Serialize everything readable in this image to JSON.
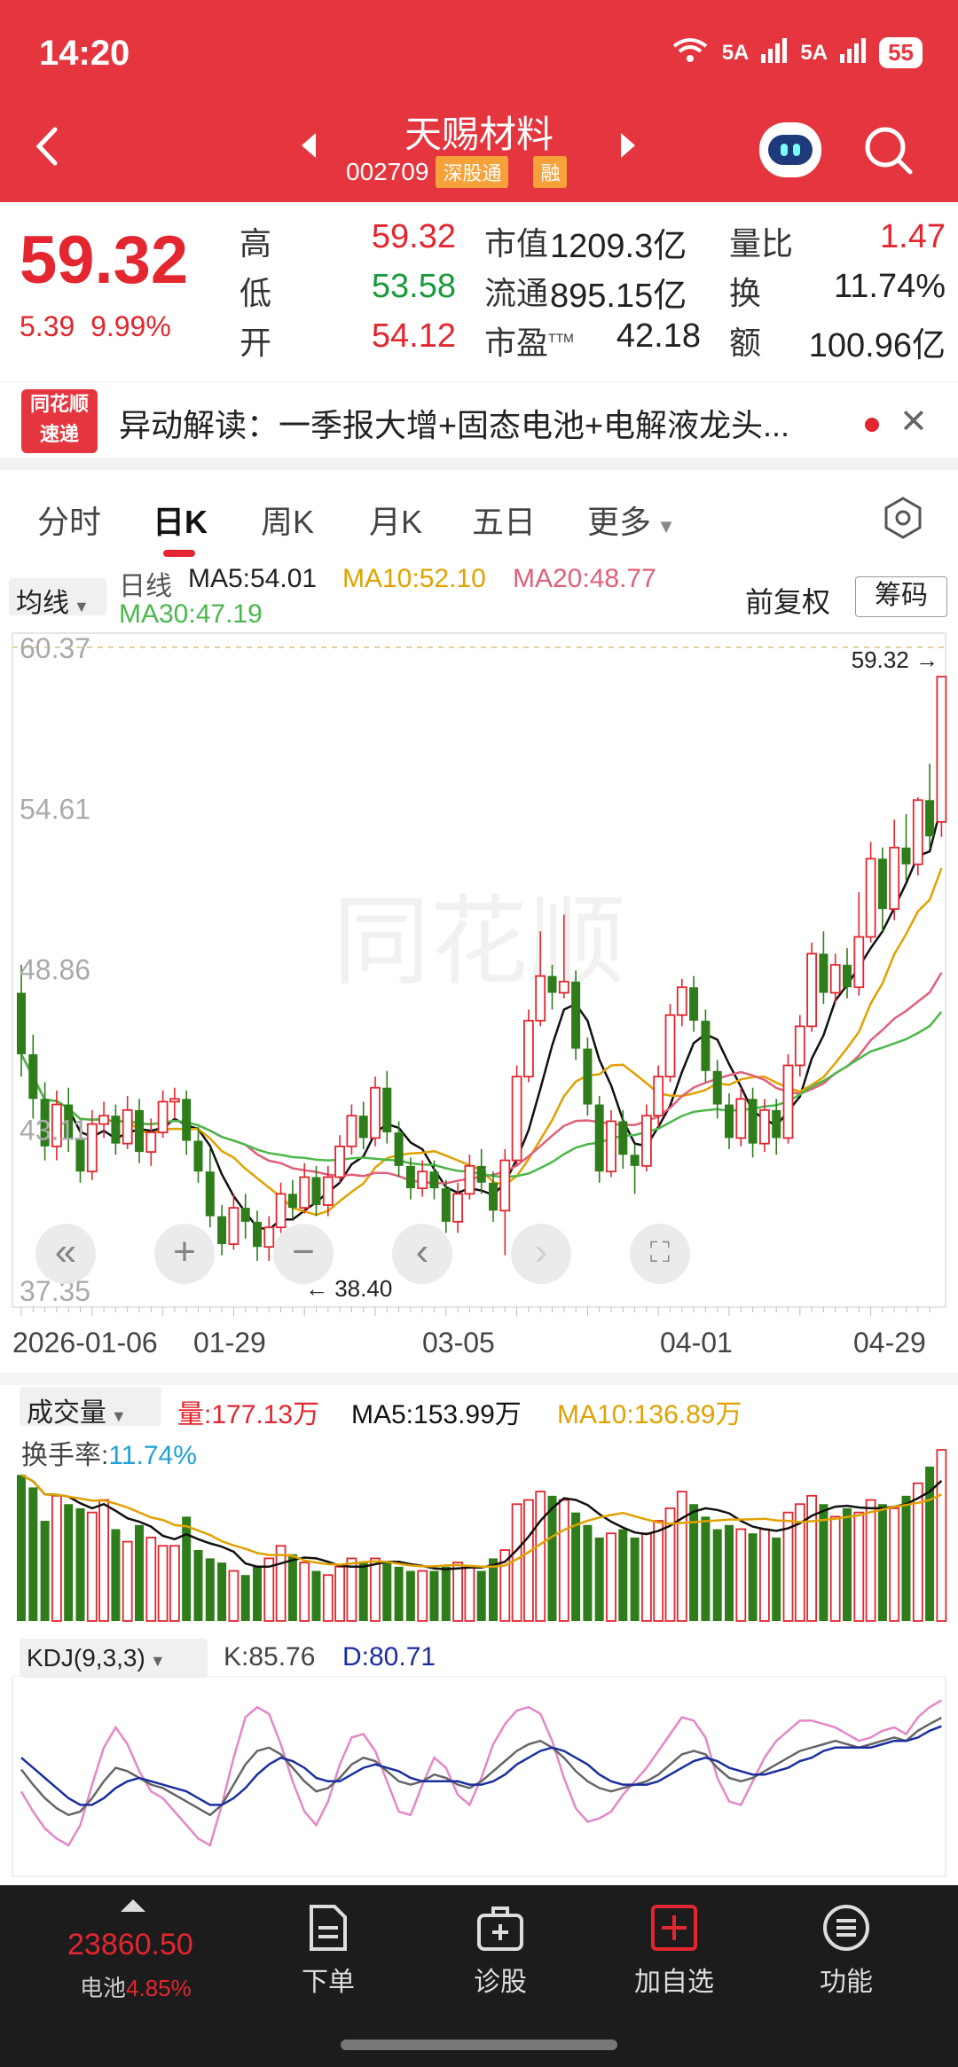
{
  "status": {
    "time": "14:20",
    "signal1": "5A",
    "signal2": "5A",
    "battery": "55"
  },
  "header": {
    "title": "天赐材料",
    "code": "002709",
    "tag1": "深股通",
    "tag2": "融"
  },
  "quote": {
    "price": "59.32",
    "change": "5.39",
    "change_pct": "9.99%",
    "high_label": "高",
    "high": "59.32",
    "low_label": "低",
    "low": "53.58",
    "open_label": "开",
    "open": "54.12",
    "mcap_label": "市值",
    "mcap": "1209.3亿",
    "float_label": "流通",
    "float": "895.15亿",
    "pe_label": "市盈",
    "pe_sup": "TTM",
    "pe": "42.18",
    "vr_label": "量比",
    "vr": "1.47",
    "turn_label": "换",
    "turn": "11.74%",
    "amt_label": "额",
    "amt": "100.96亿"
  },
  "news": {
    "logo_top": "同花顺",
    "logo_bottom": "速递",
    "text": "异动解读：一季报大增+固态电池+电解液龙头..."
  },
  "tabs": [
    "分时",
    "日K",
    "周K",
    "月K",
    "五日",
    "更多"
  ],
  "ma": {
    "select": "均线",
    "period": "日线",
    "ma5": "MA5:54.01",
    "ma10": "MA10:52.10",
    "ma20": "MA20:48.77",
    "ma30": "MA30:47.19",
    "fuquan": "前复权",
    "chouma": "筹码"
  },
  "kline": {
    "y_ticks": [
      "60.37",
      "54.61",
      "48.86",
      "43.11",
      "37.35"
    ],
    "max_label": "59.32",
    "min_label": "38.40",
    "dates": [
      "2026-01-06",
      "01-29",
      "03-05",
      "04-01",
      "04-29"
    ],
    "watermark": "同花顺"
  },
  "volume": {
    "select": "成交量",
    "vol": "量:177.13万",
    "ma5": "MA5:153.99万",
    "ma10": "MA10:136.89万",
    "turn_label": "换手率:",
    "turn": "11.74%"
  },
  "kdj": {
    "select": "KDJ(9,3,3)",
    "k": "K:85.76",
    "d": "D:80.71"
  },
  "bottom": {
    "index_value": "23860.50",
    "index_name": "电池",
    "index_pct": "4.85%",
    "items": [
      "下单",
      "诊股",
      "加自选",
      "功能"
    ]
  },
  "chart_data": {
    "type": "candlestick",
    "x_labels": [
      "2026-01-06",
      "01-29",
      "03-05",
      "04-01",
      "04-29"
    ],
    "ylim": [
      37.35,
      60.37
    ],
    "candles": [
      [
        48.0,
        45.8,
        49.0,
        45.0
      ],
      [
        45.8,
        44.2,
        46.5,
        43.5
      ],
      [
        44.2,
        42.5,
        44.8,
        42.0
      ],
      [
        42.5,
        44.0,
        44.5,
        42.0
      ],
      [
        44.0,
        42.8,
        44.6,
        42.3
      ],
      [
        42.8,
        41.6,
        43.4,
        41.2
      ],
      [
        41.6,
        43.3,
        43.8,
        41.3
      ],
      [
        43.3,
        43.6,
        44.1,
        42.8
      ],
      [
        43.6,
        42.6,
        44.0,
        42.2
      ],
      [
        42.6,
        43.8,
        44.3,
        42.4
      ],
      [
        43.8,
        42.3,
        44.2,
        41.9
      ],
      [
        42.3,
        43.0,
        43.5,
        41.8
      ],
      [
        43.0,
        44.1,
        44.5,
        42.8
      ],
      [
        44.1,
        44.2,
        44.6,
        43.5
      ],
      [
        44.2,
        42.7,
        44.5,
        42.2
      ],
      [
        42.7,
        41.6,
        43.2,
        41.2
      ],
      [
        41.6,
        40.0,
        42.4,
        39.6
      ],
      [
        40.0,
        39.0,
        40.4,
        38.6
      ],
      [
        39.0,
        40.3,
        40.8,
        38.8
      ],
      [
        40.3,
        39.8,
        40.8,
        39.2
      ],
      [
        39.8,
        38.9,
        40.2,
        38.4
      ],
      [
        38.9,
        39.6,
        40.0,
        38.4
      ],
      [
        39.6,
        40.8,
        41.2,
        39.4
      ],
      [
        40.8,
        40.3,
        41.3,
        39.9
      ],
      [
        40.3,
        41.4,
        41.9,
        40.1
      ],
      [
        41.4,
        40.4,
        41.8,
        40.0
      ],
      [
        40.4,
        41.4,
        41.8,
        40.0
      ],
      [
        41.4,
        42.5,
        42.9,
        41.2
      ],
      [
        42.5,
        43.6,
        44.0,
        42.2
      ],
      [
        43.6,
        42.8,
        44.1,
        42.4
      ],
      [
        42.8,
        44.6,
        45.0,
        42.5
      ],
      [
        44.6,
        43.0,
        45.2,
        42.6
      ],
      [
        43.0,
        41.8,
        43.4,
        41.4
      ],
      [
        41.8,
        41.0,
        42.1,
        40.6
      ],
      [
        41.0,
        41.6,
        42.0,
        40.7
      ],
      [
        41.6,
        41.0,
        42.0,
        40.6
      ],
      [
        41.0,
        39.8,
        41.3,
        39.4
      ],
      [
        39.8,
        40.8,
        41.2,
        39.4
      ],
      [
        40.8,
        41.8,
        42.2,
        40.6
      ],
      [
        41.8,
        41.2,
        42.4,
        40.8
      ],
      [
        41.2,
        40.2,
        41.6,
        39.8
      ],
      [
        40.2,
        42.0,
        42.4,
        38.6
      ],
      [
        42.0,
        45.0,
        45.4,
        41.8
      ],
      [
        45.0,
        47.0,
        47.4,
        44.8
      ],
      [
        47.0,
        48.6,
        50.2,
        46.8
      ],
      [
        48.6,
        48.0,
        49.0,
        47.4
      ],
      [
        48.0,
        48.4,
        50.8,
        47.8
      ],
      [
        48.4,
        46.0,
        48.8,
        45.6
      ],
      [
        46.0,
        44.0,
        46.4,
        43.6
      ],
      [
        44.0,
        41.6,
        44.3,
        41.2
      ],
      [
        41.6,
        43.4,
        43.8,
        41.4
      ],
      [
        43.4,
        42.2,
        43.8,
        41.7
      ],
      [
        42.2,
        41.8,
        42.6,
        40.8
      ],
      [
        41.8,
        43.6,
        44.0,
        41.6
      ],
      [
        43.6,
        45.0,
        45.4,
        43.2
      ],
      [
        45.0,
        47.2,
        47.6,
        44.8
      ],
      [
        47.2,
        48.2,
        48.5,
        46.8
      ],
      [
        48.2,
        47.0,
        48.6,
        46.6
      ],
      [
        47.0,
        45.2,
        47.4,
        44.8
      ],
      [
        45.2,
        44.0,
        45.6,
        43.5
      ],
      [
        44.0,
        42.8,
        44.4,
        42.4
      ],
      [
        42.8,
        44.2,
        44.6,
        42.5
      ],
      [
        44.2,
        42.6,
        44.6,
        42.1
      ],
      [
        42.6,
        43.8,
        44.2,
        42.3
      ],
      [
        43.8,
        42.8,
        44.2,
        42.2
      ],
      [
        42.8,
        45.4,
        45.8,
        42.6
      ],
      [
        45.4,
        46.8,
        47.2,
        45.0
      ],
      [
        46.8,
        49.4,
        49.8,
        46.6
      ],
      [
        49.4,
        48.0,
        50.2,
        47.6
      ],
      [
        48.0,
        49.0,
        49.4,
        47.6
      ],
      [
        49.0,
        48.2,
        49.6,
        47.8
      ],
      [
        48.2,
        50.0,
        51.6,
        47.9
      ],
      [
        50.0,
        52.8,
        53.4,
        49.8
      ],
      [
        52.8,
        51.0,
        53.2,
        50.2
      ],
      [
        51.0,
        53.2,
        54.2,
        50.6
      ],
      [
        53.2,
        52.6,
        54.4,
        52.0
      ],
      [
        52.6,
        54.9,
        55.0,
        52.2
      ],
      [
        54.9,
        53.6,
        56.2,
        53.2
      ],
      [
        54.12,
        59.32,
        59.32,
        53.58
      ]
    ],
    "volume": [
      70,
      64,
      48,
      60,
      56,
      54,
      52,
      58,
      44,
      38,
      46,
      40,
      36,
      36,
      50,
      34,
      30,
      28,
      24,
      22,
      26,
      30,
      36,
      32,
      28,
      24,
      22,
      26,
      30,
      28,
      30,
      28,
      26,
      24,
      24,
      24,
      26,
      28,
      26,
      24,
      30,
      34,
      56,
      58,
      62,
      60,
      58,
      52,
      46,
      40,
      42,
      44,
      40,
      42,
      48,
      54,
      62,
      56,
      50,
      44,
      46,
      44,
      42,
      44,
      40,
      52,
      56,
      60,
      56,
      50,
      54,
      52,
      58,
      56,
      54,
      60,
      66,
      74,
      82
    ],
    "kdj_k": [
      55,
      46,
      38,
      32,
      28,
      30,
      38,
      48,
      56,
      54,
      50,
      46,
      44,
      40,
      36,
      32,
      28,
      34,
      46,
      58,
      66,
      68,
      64,
      56,
      48,
      42,
      44,
      50,
      58,
      62,
      60,
      54,
      48,
      46,
      48,
      52,
      50,
      46,
      44,
      48,
      54,
      60,
      66,
      70,
      72,
      68,
      62,
      54,
      48,
      44,
      42,
      44,
      46,
      48,
      52,
      58,
      64,
      66,
      64,
      56,
      50,
      48,
      50,
      54,
      58,
      62,
      66,
      68,
      70,
      72,
      70,
      68,
      70,
      72,
      74,
      72,
      78,
      82,
      85.76
    ],
    "kdj_d": [
      62,
      56,
      50,
      44,
      38,
      34,
      34,
      38,
      44,
      48,
      50,
      48,
      46,
      44,
      42,
      38,
      34,
      34,
      38,
      44,
      52,
      58,
      62,
      60,
      56,
      50,
      48,
      48,
      52,
      56,
      58,
      56,
      54,
      50,
      48,
      48,
      48,
      48,
      46,
      46,
      48,
      52,
      58,
      62,
      66,
      68,
      66,
      62,
      58,
      52,
      48,
      46,
      46,
      46,
      48,
      52,
      56,
      60,
      62,
      60,
      56,
      54,
      52,
      52,
      54,
      56,
      60,
      62,
      66,
      68,
      68,
      68,
      68,
      70,
      72,
      72,
      74,
      78,
      80.71
    ],
    "kdj_j": [
      42,
      30,
      20,
      14,
      10,
      22,
      46,
      68,
      80,
      70,
      54,
      42,
      38,
      30,
      22,
      14,
      10,
      34,
      62,
      86,
      92,
      88,
      70,
      48,
      30,
      22,
      36,
      58,
      74,
      76,
      66,
      48,
      30,
      28,
      46,
      62,
      56,
      40,
      34,
      50,
      70,
      82,
      90,
      92,
      88,
      72,
      50,
      32,
      24,
      26,
      30,
      40,
      48,
      56,
      66,
      76,
      86,
      84,
      74,
      50,
      36,
      34,
      48,
      62,
      72,
      78,
      84,
      84,
      82,
      80,
      76,
      72,
      74,
      78,
      80,
      76,
      86,
      92,
      96
    ]
  }
}
